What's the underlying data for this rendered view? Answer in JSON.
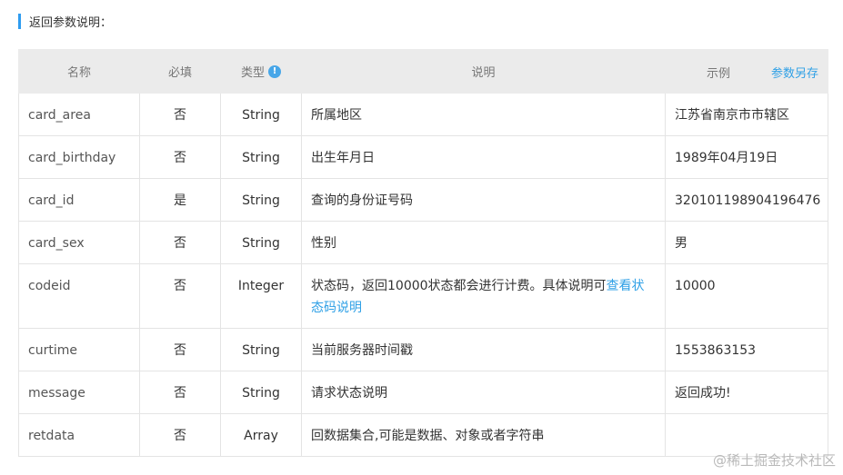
{
  "section_title": "返回参数说明：",
  "headers": {
    "name": "名称",
    "required": "必填",
    "type": "类型",
    "type_info_icon": "info-icon",
    "desc": "说明",
    "example": "示例",
    "save_link": "参数另存"
  },
  "rows": [
    {
      "name": "card_area",
      "required": "否",
      "type": "String",
      "desc": "所属地区",
      "example": "江苏省南京市市辖区"
    },
    {
      "name": "card_birthday",
      "required": "否",
      "type": "String",
      "desc": "出生年月日",
      "example": "1989年04月19日"
    },
    {
      "name": "card_id",
      "required": "是",
      "type": "String",
      "desc": "查询的身份证号码",
      "example": "320101198904196476"
    },
    {
      "name": "card_sex",
      "required": "否",
      "type": "String",
      "desc": "性别",
      "example": "男"
    },
    {
      "name": "codeid",
      "required": "否",
      "type": "Integer",
      "desc": "状态码，返回10000状态都会进行计费。具体说明可",
      "desc_link": "查看状态码说明",
      "example": "10000"
    },
    {
      "name": "curtime",
      "required": "否",
      "type": "String",
      "desc": "当前服务器时间戳",
      "example": "1553863153"
    },
    {
      "name": "message",
      "required": "否",
      "type": "String",
      "desc": "请求状态说明",
      "example": "返回成功!"
    },
    {
      "name": "retdata",
      "required": "否",
      "type": "Array",
      "desc": "回数据集合,可能是数据、对象或者字符串",
      "example": ""
    }
  ],
  "watermark": "@稀土掘金技术社区",
  "colors": {
    "accent": "#2e9cf0",
    "link": "#2fa0e6",
    "header_bg": "#ebebeb"
  }
}
